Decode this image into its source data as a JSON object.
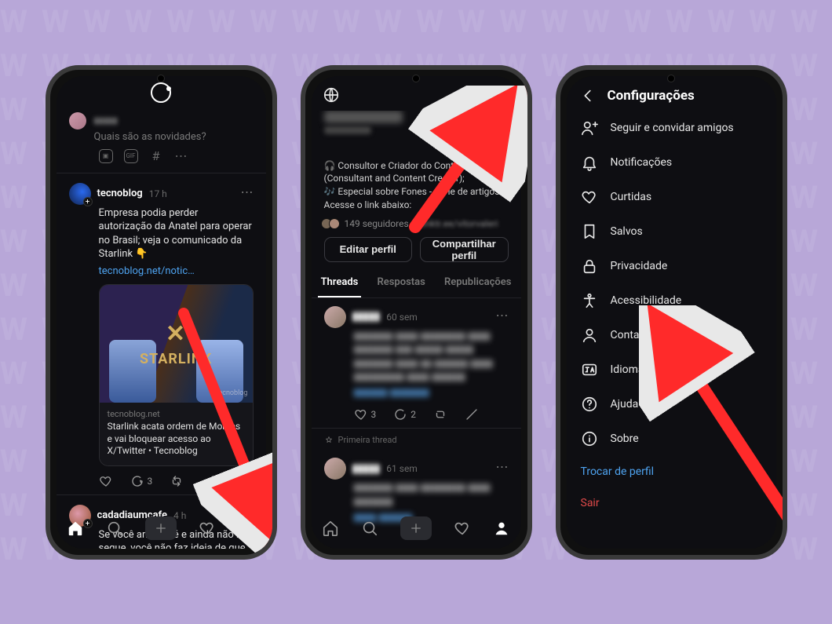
{
  "screen1": {
    "composer_placeholder": "Quais são as novidades?",
    "post1": {
      "user": "tecnoblog",
      "time": "17 h",
      "text": "Empresa podia perder autorização da Anatel para operar no Brasil; veja o comunicado da Starlink 👇",
      "link": "tecnoblog.net/notic…",
      "card_title_word": "STARLINK",
      "card_watermark": "tecnoblog",
      "card_domain": "tecnoblog.net",
      "card_title": "Starlink acata ordem de Moraes e vai bloquear acesso ao X/Twitter • Tecnoblog",
      "comments": "3"
    },
    "post2": {
      "user": "cadadiaumcafe",
      "time": "4 h",
      "text": "Se você ama café e ainda não me segue, você não faz ideia de que o seu café pode ser mil vezes melhor."
    }
  },
  "screen2": {
    "bio_line1": "🎧 Consultor e Criador do Conteúdo (Consultant and Content Creator);",
    "bio_line2": "🎶 Especial sobre Fones - Série de artigos. Acesse o link abaixo:",
    "followers_count": "149 seguidores",
    "followers_link": "linktr.ee/vitorvaleri",
    "btn_edit": "Editar perfil",
    "btn_share": "Compartilhar perfil",
    "tab_threads": "Threads",
    "tab_replies": "Respostas",
    "tab_reposts": "Republicações",
    "p1_time": "60 sem",
    "p1_c": "3",
    "p1_r": "2",
    "first_thread": "Primeira thread",
    "p2_time": "61 sem"
  },
  "screen3": {
    "title": "Configurações",
    "items": [
      {
        "icon": "follow",
        "label": "Seguir e convidar amigos"
      },
      {
        "icon": "bell",
        "label": "Notificações"
      },
      {
        "icon": "heart",
        "label": "Curtidas"
      },
      {
        "icon": "bookmark",
        "label": "Salvos"
      },
      {
        "icon": "lock",
        "label": "Privacidade"
      },
      {
        "icon": "access",
        "label": "Acessibilidade"
      },
      {
        "icon": "user",
        "label": "Conta"
      },
      {
        "icon": "lang",
        "label": "Idioma"
      },
      {
        "icon": "help",
        "label": "Ajuda"
      },
      {
        "icon": "info",
        "label": "Sobre"
      }
    ],
    "switch_profile": "Trocar de perfil",
    "logout": "Sair"
  }
}
